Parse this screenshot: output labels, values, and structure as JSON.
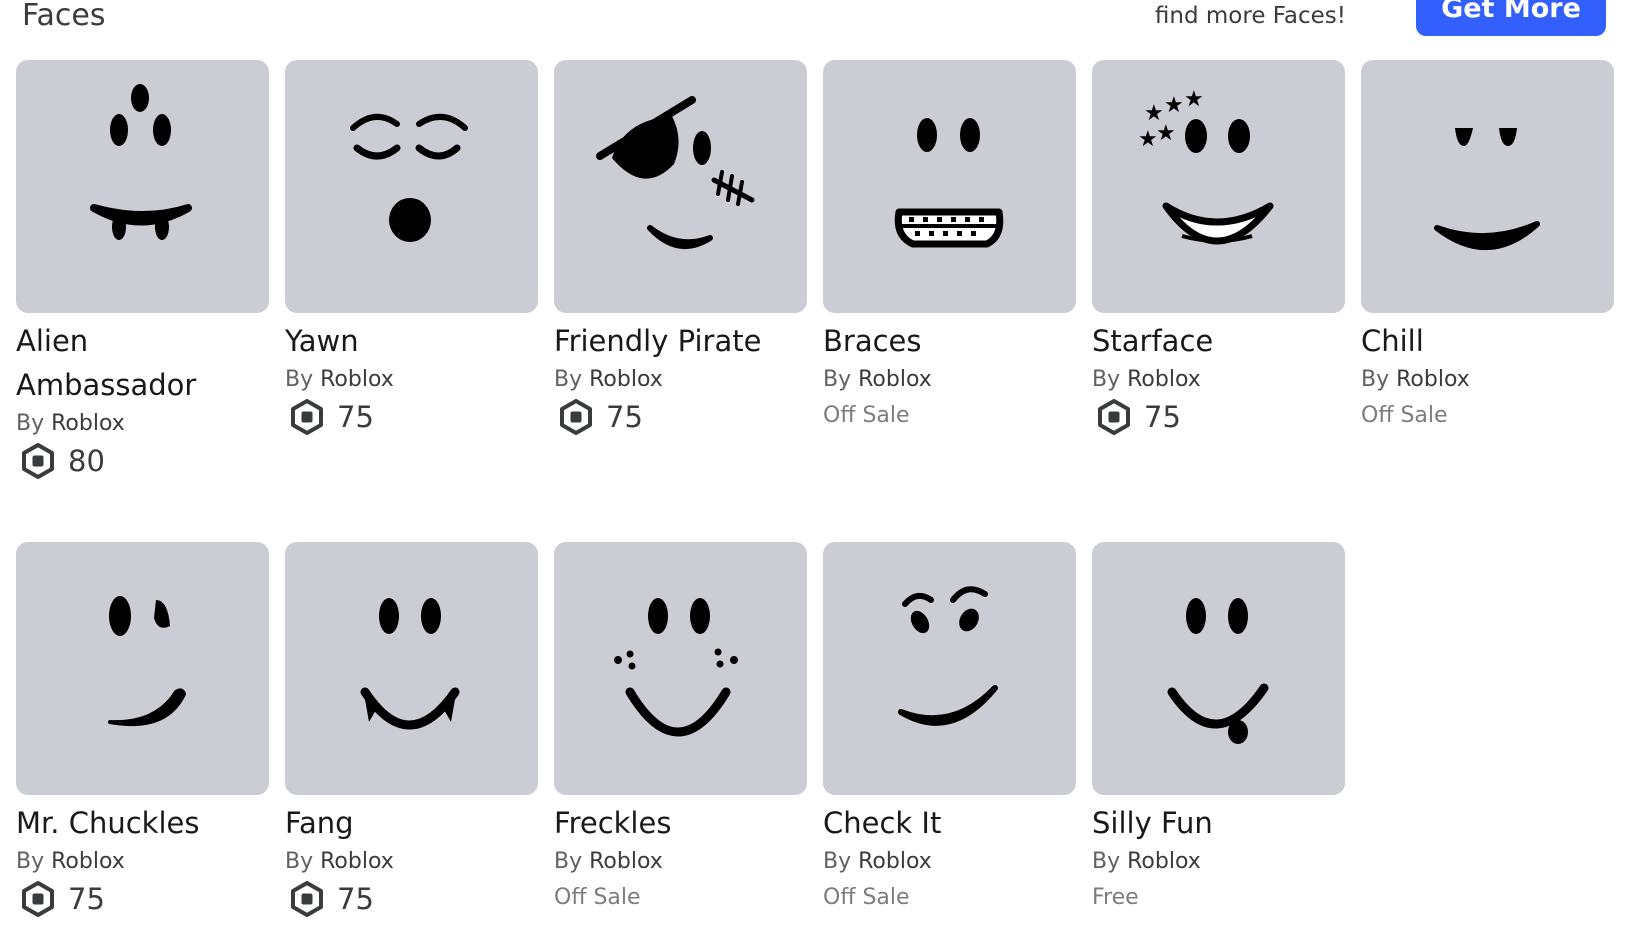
{
  "header": {
    "title": "Faces",
    "hint": "find more Faces!",
    "get_more_label": "Get More"
  },
  "items": [
    {
      "name": "Alien Ambassador",
      "by": "By",
      "creator": "Roblox",
      "price": "80",
      "status": "",
      "icon": "alien-ambassador-face"
    },
    {
      "name": "Yawn",
      "by": "By",
      "creator": "Roblox",
      "price": "75",
      "status": "",
      "icon": "yawn-face"
    },
    {
      "name": "Friendly Pirate",
      "by": "By",
      "creator": "Roblox",
      "price": "75",
      "status": "",
      "icon": "friendly-pirate-face"
    },
    {
      "name": "Braces",
      "by": "By",
      "creator": "Roblox",
      "price": "",
      "status": "Off Sale",
      "icon": "braces-face"
    },
    {
      "name": "Starface",
      "by": "By",
      "creator": "Roblox",
      "price": "75",
      "status": "",
      "icon": "starface-face"
    },
    {
      "name": "Chill",
      "by": "By",
      "creator": "Roblox",
      "price": "",
      "status": "Off Sale",
      "icon": "chill-face"
    },
    {
      "name": "Mr. Chuckles",
      "by": "By",
      "creator": "Roblox",
      "price": "75",
      "status": "",
      "icon": "mr-chuckles-face"
    },
    {
      "name": "Fang",
      "by": "By",
      "creator": "Roblox",
      "price": "75",
      "status": "",
      "icon": "fang-face"
    },
    {
      "name": "Freckles",
      "by": "By",
      "creator": "Roblox",
      "price": "",
      "status": "Off Sale",
      "icon": "freckles-face"
    },
    {
      "name": "Check It",
      "by": "By",
      "creator": "Roblox",
      "price": "",
      "status": "Off Sale",
      "icon": "check-it-face"
    },
    {
      "name": "Silly Fun",
      "by": "By",
      "creator": "Roblox",
      "price": "",
      "status": "Free",
      "icon": "silly-fun-face"
    }
  ],
  "colors": {
    "accent": "#335fff",
    "thumb_bg": "#cccdd4",
    "text": "#393b3d",
    "muted": "#7a7c7e"
  }
}
